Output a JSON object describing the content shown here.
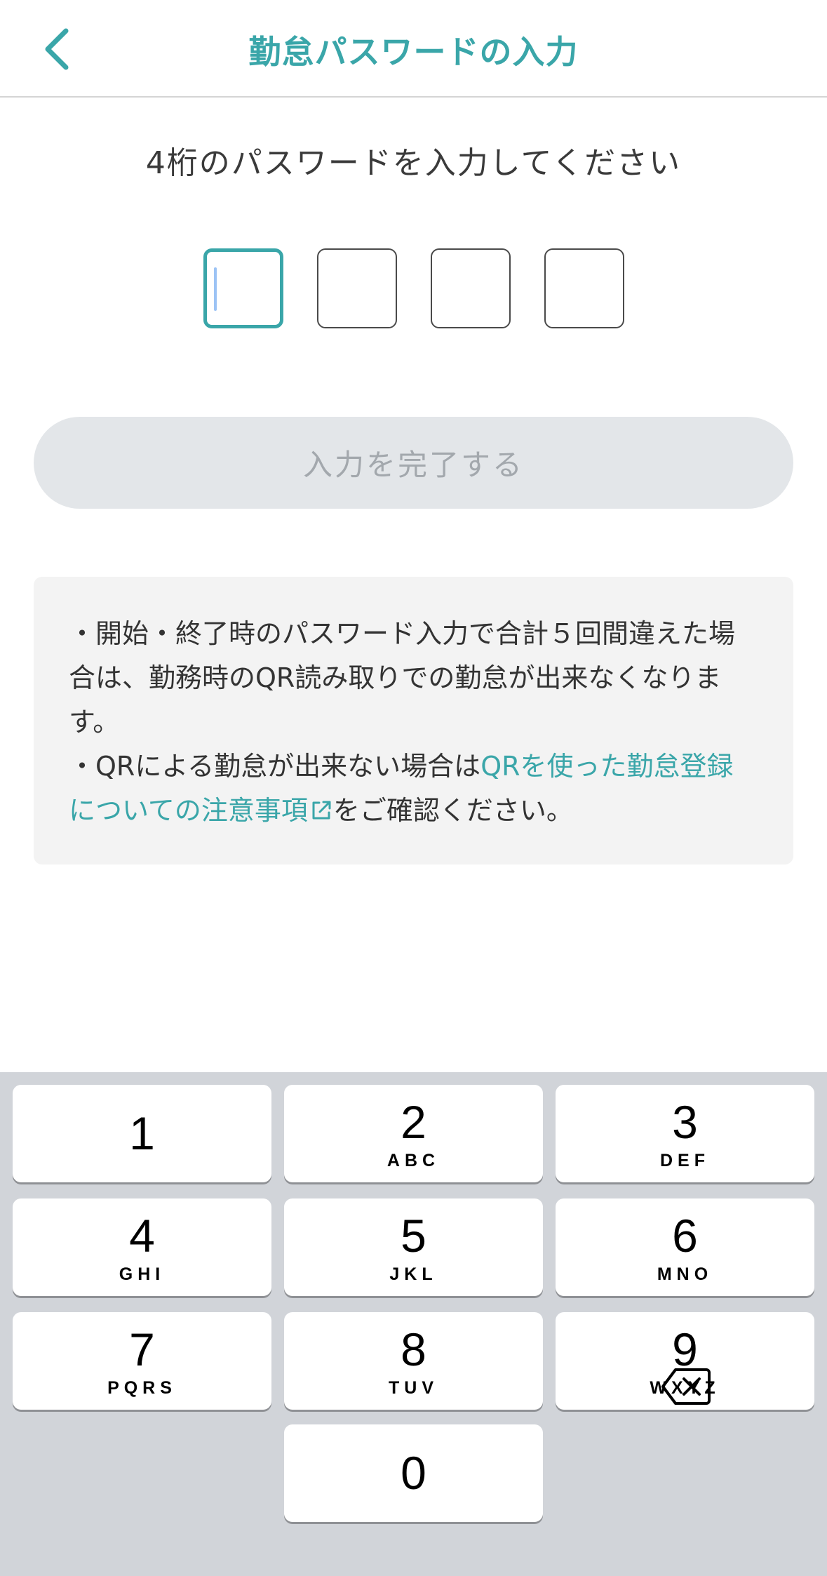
{
  "header": {
    "title": "勤怠パスワードの入力",
    "back_icon": "chevron-left-icon",
    "accent_color": "#3aa6a9"
  },
  "instruction": "4桁のパスワードを入力してください",
  "pin": {
    "length": 4,
    "filled": 0,
    "active_index": 0
  },
  "submit": {
    "label": "入力を完了する",
    "enabled": false
  },
  "notice": {
    "line1": "・開始・終了時のパスワード入力で合計５回間違えた場合は、勤務時のQR読み取りでの勤怠が出来なくなります。",
    "line2_prefix": "・QRによる勤怠が出来ない場合は",
    "line2_link": "QRを使った勤怠登録についての注意事項",
    "line2_link_icon": "external-link-icon",
    "line2_suffix": "をご確認ください。"
  },
  "keypad": {
    "keys": [
      {
        "num": "1",
        "letters": ""
      },
      {
        "num": "2",
        "letters": "ABC"
      },
      {
        "num": "3",
        "letters": "DEF"
      },
      {
        "num": "4",
        "letters": "GHI"
      },
      {
        "num": "5",
        "letters": "JKL"
      },
      {
        "num": "6",
        "letters": "MNO"
      },
      {
        "num": "7",
        "letters": "PQRS"
      },
      {
        "num": "8",
        "letters": "TUV"
      },
      {
        "num": "9",
        "letters": "WXYZ"
      },
      {
        "num": "0",
        "letters": ""
      }
    ],
    "delete_icon": "backspace-icon"
  }
}
